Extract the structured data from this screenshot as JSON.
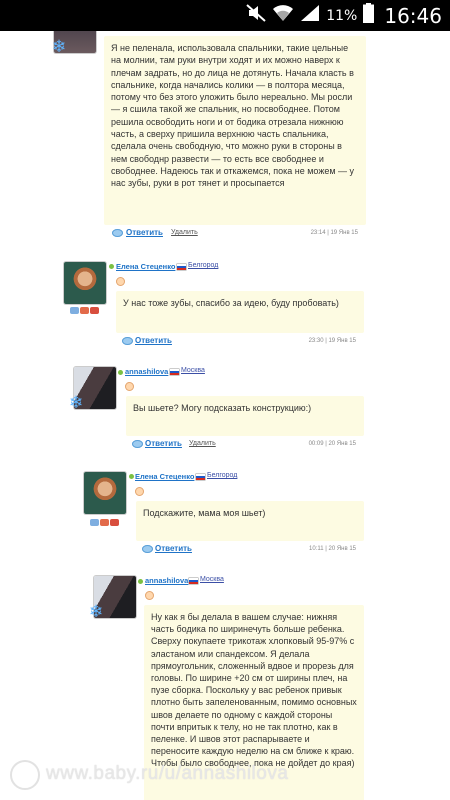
{
  "status_bar": {
    "battery_percent": "11%",
    "time": "16:46",
    "icons": [
      "mute-icon",
      "wifi-icon",
      "signal-icon",
      "battery-icon"
    ]
  },
  "posts": [
    {
      "text": "Я не пеленала, использовала спальники, такие цельные на молнии, там руки внутри ходят и их можно наверх к плечам задрать, но до лица не дотянуть. Начала класть в спальнике, когда начались колики — в полтора месяца, потому что без этого уложить было нереально. Мы росли — я сшила такой же спальник, но посвободнее. Потом решила освободить ноги и от бодика отрезала нижнюю часть, а сверху пришила верхнюю часть спальника, сделала очень свободную, что можно руки в стороны в нем свободнр развести — то есть все свободнее и свободнее. Надеюсь так и откажемся, пока не можем — у нас зубы, руки в рот тянет и просыпается",
      "reply": "Ответить",
      "delete": "Удалить",
      "timestamp": "23:14 | 19 Янв 15"
    },
    {
      "author": "Елена Стеценко",
      "city": "Белгород",
      "text": "У нас тоже зубы, спасибо за идею, буду пробовать)",
      "reply": "Ответить",
      "timestamp": "23:30 | 19 Янв 15"
    },
    {
      "author": "annashilova",
      "city": "Москва",
      "text": "Вы шьете? Могу подсказать конструкцию:)",
      "reply": "Ответить",
      "delete": "Удалить",
      "timestamp": "00:09 | 20 Янв 15"
    },
    {
      "author": "Елена Стеценко",
      "city": "Белгород",
      "text": "Подскажите, мама моя шьет)",
      "reply": "Ответить",
      "timestamp": "10:11 | 20 Янв 15"
    },
    {
      "author": "annashilova",
      "city": "Москва",
      "text": "Ну как я бы делала в вашем случае: нижняя часть бодика по ширинечуть больше ребенка. Сверху покупаете трикотаж хлопковый 95-97% с эластаном или спандексом. Я делала прямоугольник, сложенный вдвое и прорезь для головы. По ширине +20 см от ширины плеч, на пузе сборка. Поскольку у вас ребенок привык плотно быть запеленованным, помимо основных швов делаете по одному с каждой стороны почти впритык к телу, но не так плотно, как в пеленке. И швов этот распарываете и переносите каждую неделю на см ближе к краю. Чтобы было свободнее, пока не дойдет до края)"
    }
  ],
  "watermark": "www.baby.ru/u/annashilova"
}
